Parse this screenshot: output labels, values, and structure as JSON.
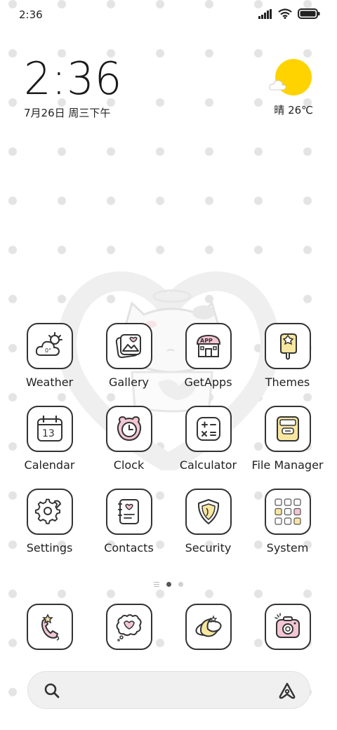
{
  "status_bar": {
    "time": "2:36",
    "icons": [
      "signal-icon",
      "wifi-icon",
      "battery-icon"
    ]
  },
  "clock_widget": {
    "time": "2:36",
    "date": "7月26日 周三下午"
  },
  "weather_widget": {
    "text": "晴 26℃",
    "icon": "sun-cloud-icon",
    "sun_color": "#ffd300"
  },
  "apps": [
    {
      "label": "Weather",
      "icon": "weather-icon"
    },
    {
      "label": "Gallery",
      "icon": "gallery-icon"
    },
    {
      "label": "GetApps",
      "icon": "getapps-icon"
    },
    {
      "label": "Themes",
      "icon": "themes-icon"
    },
    {
      "label": "Calendar",
      "icon": "calendar-icon",
      "badge": "13"
    },
    {
      "label": "Clock",
      "icon": "clock-icon"
    },
    {
      "label": "Calculator",
      "icon": "calculator-icon"
    },
    {
      "label": "File Manager",
      "icon": "file-manager-icon"
    },
    {
      "label": "Settings",
      "icon": "settings-icon"
    },
    {
      "label": "Contacts",
      "icon": "contacts-icon"
    },
    {
      "label": "Security",
      "icon": "security-icon"
    },
    {
      "label": "System",
      "icon": "system-folder-icon"
    }
  ],
  "page_indicator": {
    "pages": 2,
    "current": 1
  },
  "dock": [
    {
      "icon": "phone-icon"
    },
    {
      "icon": "messages-icon"
    },
    {
      "icon": "browser-icon"
    },
    {
      "icon": "camera-icon"
    }
  ],
  "search_bar": {
    "left_icon": "search-icon",
    "right_icon": "assistant-icon"
  },
  "colors": {
    "accent_pink": "#f4c6d3",
    "accent_yellow": "#f8e7a0",
    "outline": "#333333"
  }
}
